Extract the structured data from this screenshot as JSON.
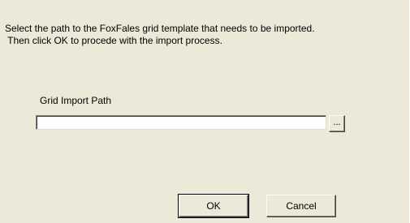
{
  "dialog": {
    "instructions": "Select the path to the FoxFales grid template that needs to be imported.\n Then click OK to procede with the import process.",
    "path_label": "Grid Import Path",
    "path_value": "",
    "browse_label": "...",
    "ok_label": "OK",
    "cancel_label": "Cancel"
  }
}
